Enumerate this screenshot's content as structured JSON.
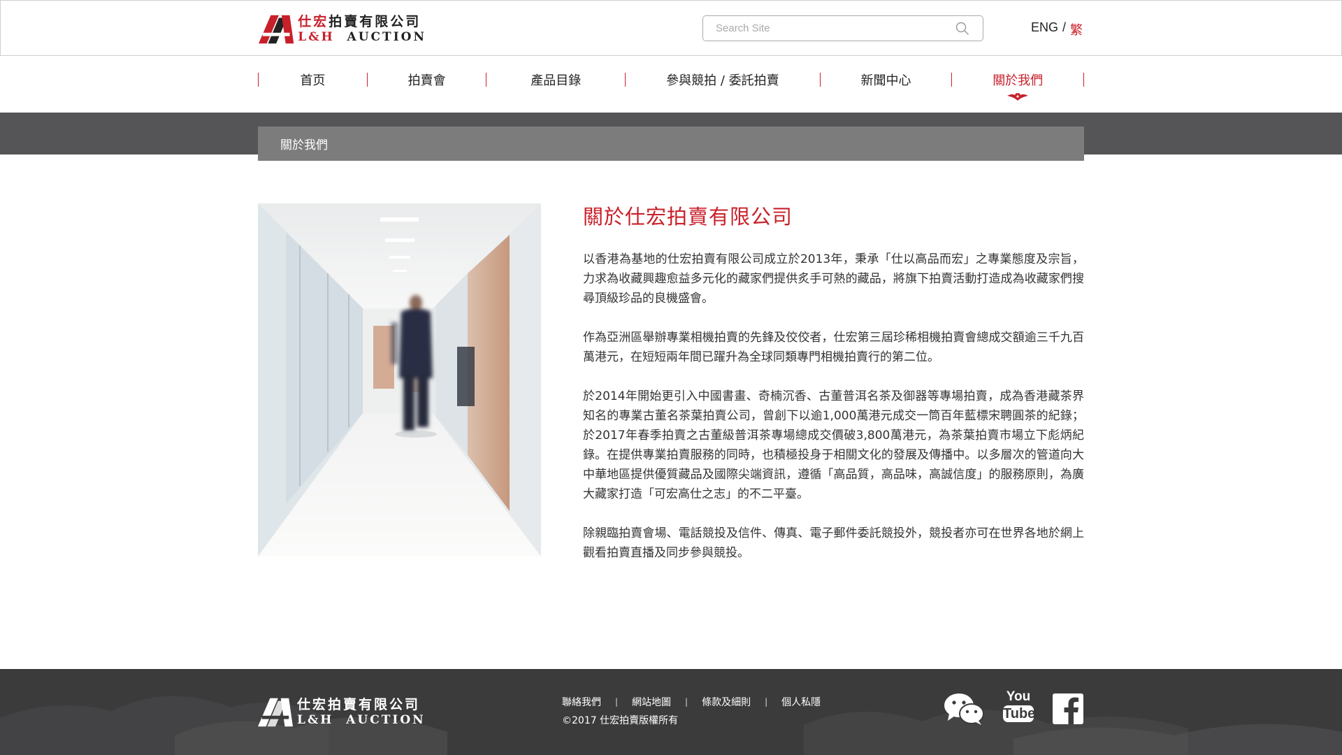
{
  "header": {
    "logo_cn_red": "仕宏",
    "logo_cn_dark": "拍賣有限公司",
    "logo_en_red": "L&H",
    "logo_en_dark": "AUCTION",
    "search_placeholder": "Search Site",
    "lang_eng": "ENG",
    "lang_sep": "/",
    "lang_trad": "繁"
  },
  "nav": {
    "items": [
      {
        "label": "首页"
      },
      {
        "label": "拍賣會"
      },
      {
        "label": "產品目錄"
      },
      {
        "label": "參與競拍 / 委託拍賣"
      },
      {
        "label": "新聞中心"
      },
      {
        "label": "關於我們"
      }
    ],
    "active_index": 5
  },
  "breadcrumb": "關於我們",
  "article": {
    "title": "關於仕宏拍賣有限公司",
    "paragraphs": [
      "以香港為基地的仕宏拍賣有限公司成立於2013年，秉承「仕以高品而宏」之專業態度及宗旨，力求為收藏興趣愈益多元化的藏家們提供炙手可熱的藏品，將旗下拍賣活動打造成為收藏家們搜尋頂級珍品的良機盛會。",
      "作為亞洲區舉辦專業相機拍賣的先鋒及佼佼者，仕宏第三屆珍稀相機拍賣會總成交額逾三千九百萬港元，在短短兩年間已躍升為全球同類專門相機拍賣行的第二位。",
      "於2014年開始更引入中國書畫、奇楠沉香、古董普洱名茶及御器等專場拍賣，成為香港藏茶界知名的專業古董名茶葉拍賣公司，曾創下以逾1,000萬港元成交一筒百年藍標宋聘圓茶的紀錄；於2017年春季拍賣之古董級普洱茶專場總成交價破3,800萬港元，為茶葉拍賣市場立下彪炳紀錄。在提供專業拍賣服務的同時，也積極投身于相關文化的發展及傳播中。以多層次的管道向大中華地區提供優質藏品及國際尖端資訊，遵循「高品質，高品味，高誠信度」的服務原則，為廣大藏家打造「可宏高仕之志」的不二平臺。",
      "除親臨拍賣會場、電話競投及信件、傳真、電子郵件委託競投外，競投者亦可在世界各地於網上觀看拍賣直播及同步參與競投。"
    ]
  },
  "footer": {
    "links": [
      "聯絡我們",
      "網站地圖",
      "條款及細則",
      "個人私隱"
    ],
    "link_sep": "|",
    "copyright": "©2017 仕宏拍賣版權所有",
    "social": [
      {
        "icon": "wechat-icon"
      },
      {
        "icon": "youtube-icon",
        "text_top": "You",
        "text_bottom": "Tube"
      },
      {
        "icon": "facebook-icon"
      }
    ]
  },
  "colors": {
    "accent": "#c8202a",
    "band": "#555557",
    "crumb": "#7c7c7d",
    "footer": "#3b3b3c"
  }
}
